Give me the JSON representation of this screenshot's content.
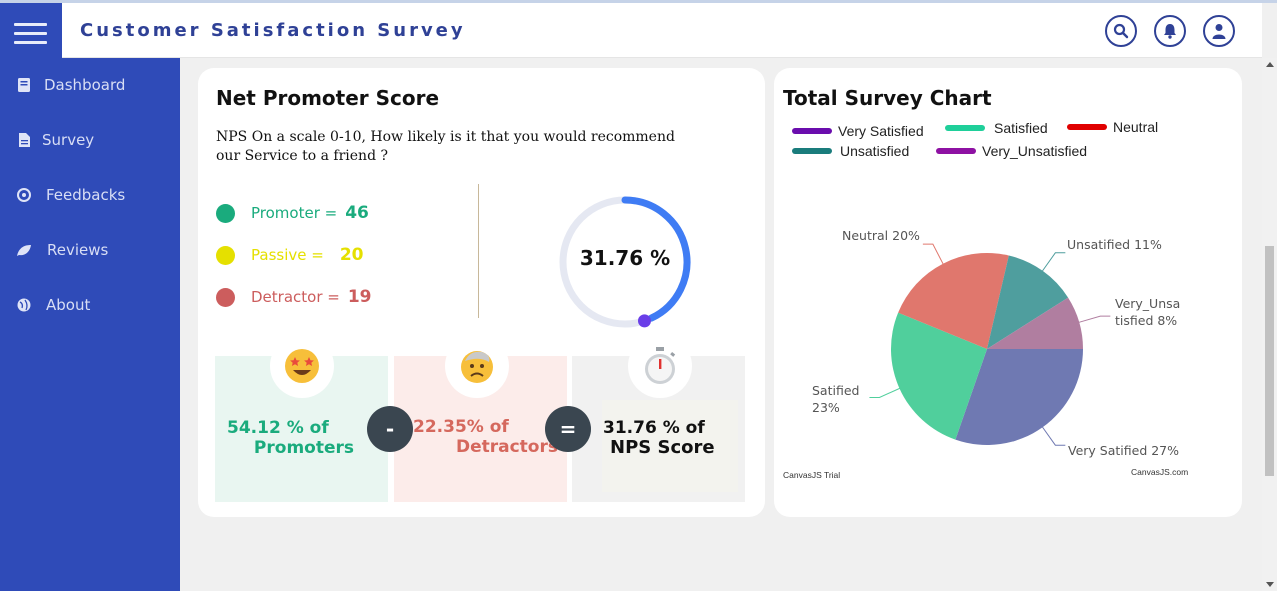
{
  "app": {
    "title": "Customer Satisfaction Survey"
  },
  "header": {
    "icons": [
      "search-icon",
      "bell-icon",
      "user-icon"
    ]
  },
  "sidebar": {
    "items": [
      {
        "label": "Dashboard",
        "icon": "dashboard-icon"
      },
      {
        "label": "Survey",
        "icon": "file-icon"
      },
      {
        "label": "Feedbacks",
        "icon": "feedback-icon"
      },
      {
        "label": "Reviews",
        "icon": "leaf-icon"
      },
      {
        "label": "About",
        "icon": "globe-icon"
      }
    ]
  },
  "nps": {
    "title": "Net Promoter Score",
    "question": "NPS On a scale 0-10, How likely is it that you would recommend our Service to a friend ?",
    "promoter": {
      "label": "Promoter =",
      "value": "46",
      "color": "#1aab7d"
    },
    "passive": {
      "label": "Passive =",
      "value": "20",
      "color": "#e5e000"
    },
    "detractor": {
      "label": "Detractor =",
      "value": "19",
      "color": "#cc5d5d"
    },
    "score": {
      "text": "31.76 %",
      "fraction": 0.3176
    },
    "calc": {
      "promoters_line1": "54.12 % of",
      "promoters_line2": "Promoters",
      "minus": "-",
      "detractors_line1": "22.35% of",
      "detractors_line2": "Detractors",
      "equals": "=",
      "nps_line1": "31.76 % of",
      "nps_line2": "NPS Score"
    }
  },
  "survey_chart": {
    "title": "Total Survey Chart",
    "credit_left": "CanvasJS Trial",
    "credit_right": "CanvasJS.com"
  },
  "chart_data": {
    "type": "pie",
    "legend": [
      {
        "name": "Very Satisfied",
        "color": "#6a0dad"
      },
      {
        "name": "Satisfied",
        "color": "#1fcf9a"
      },
      {
        "name": "Neutral",
        "color": "#e00000"
      },
      {
        "name": "Unsatisfied",
        "color": "#1a7c7c"
      },
      {
        "name": "Very_Unsatisfied",
        "color": "#8e11a3"
      }
    ],
    "slices": [
      {
        "name": "Very Satified",
        "value": 27,
        "label": "Very Satified 27%",
        "color": "#6f79b2"
      },
      {
        "name": "Satified",
        "value": 23,
        "label": "Satified\n23%",
        "color": "#50cf9c"
      },
      {
        "name": "Neutral",
        "value": 20,
        "label": "Neutral 20%",
        "color": "#e0776d"
      },
      {
        "name": "Unsatified",
        "value": 11,
        "label": "Unsatified 11%",
        "color": "#4f9e9e"
      },
      {
        "name": "Very_Unsatisfied",
        "value": 8,
        "label": "Very_Unsa\ntisfied 8%",
        "color": "#b07ea0"
      }
    ]
  }
}
